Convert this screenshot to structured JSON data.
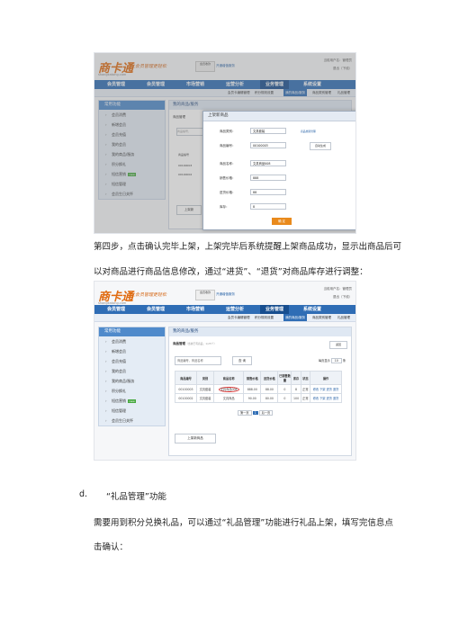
{
  "screenshot1": {
    "app_name": "商卡通",
    "logo_sub": "shangkatong.com",
    "slogan": "让会员管理更轻松",
    "header_box": "会员收款",
    "header_open": "开通增值服务",
    "top_right": [
      "当前用户名：",
      "管理员"
    ],
    "top_right2": "退出（下线）",
    "nav": [
      "会员管理",
      "会员管理",
      "市场营销",
      "运营分析",
      "业务管理",
      "系统设置"
    ],
    "subnav": [
      "会员卡编辑管理",
      "积分规则设置",
      "我的商品/服务",
      "商品类别管理",
      "礼品管理"
    ],
    "sidebar_title": "常用功能",
    "sidebar": [
      "会员消费",
      "新增会员",
      "会员充值",
      "我的会员",
      "我的商品/服务",
      "积分换礼",
      "短信营销",
      "短信管理",
      "会员生日关怀"
    ],
    "new_tag": "new",
    "main_title": "我的商品/服务",
    "bg_filter_label": "商品管理",
    "bg_search_placeholder": "商品编号、",
    "bg_cols": [
      "商品编号",
      "操作"
    ],
    "bg_rows": [
      "00100003",
      "00100002"
    ],
    "bg_add_button": "上架新",
    "dialog": {
      "title": "上架新商品",
      "close": "×",
      "fields": [
        {
          "label": "商品类别：",
          "value": "文具套装"
        },
        {
          "label": "商品编号：",
          "value": "00100003"
        },
        {
          "label": "商品名称：",
          "value": "文具商品008"
        },
        {
          "label": "销售价格：",
          "value": "888"
        },
        {
          "label": "进货价格：",
          "value": "88"
        },
        {
          "label": "库存：",
          "value": "8"
        }
      ],
      "code_button": "自动生成",
      "manage_link": "商品类别管理",
      "submit": "确 定"
    }
  },
  "paragraph1_line1": "第四步，点击确认完毕上架，上架完毕后系统提醒上架商品成功，显示出商品后可",
  "paragraph1_line2": "以对商品进行商品信息修改，通过“进货”、“退货”对商品库存进行调整：",
  "screenshot2": {
    "main_title": "我的商品/服务",
    "panel_title": "商品管理",
    "panel_note": "（当前已有商品：1/25个）",
    "back": "返回",
    "search_placeholder": "商品编号、商品名称",
    "search_button": "查 询",
    "per_page_label": "每页显示",
    "per_page_value": "10",
    "per_page_unit": "条",
    "columns": [
      "商品编号",
      "类别",
      "商品名称",
      "销售价格",
      "进货价格",
      "已销售数量",
      "库存",
      "状态",
      "操作"
    ],
    "rows": [
      [
        "00100003",
        "文具套装",
        "文具商品008",
        "888.00",
        "88.00",
        "0",
        "8",
        "正常",
        "修改 下架 进货 退货"
      ],
      [
        "00100002",
        "文具套装",
        "文具商品",
        "90.00",
        "80.00",
        "0",
        "100",
        "正常",
        "修改 下架 进货 退货"
      ]
    ],
    "pager": [
      "第一页",
      "1",
      "后一页"
    ],
    "add_button": "上架新商品"
  },
  "section_d": "d.",
  "section_d_title": "“礼品管理”功能",
  "paragraph2_line1": "需要用到积分兑换礼品，可以通过“礼品管理”功能进行礼品上架，填写完信息点",
  "paragraph2_line2": "击确认："
}
